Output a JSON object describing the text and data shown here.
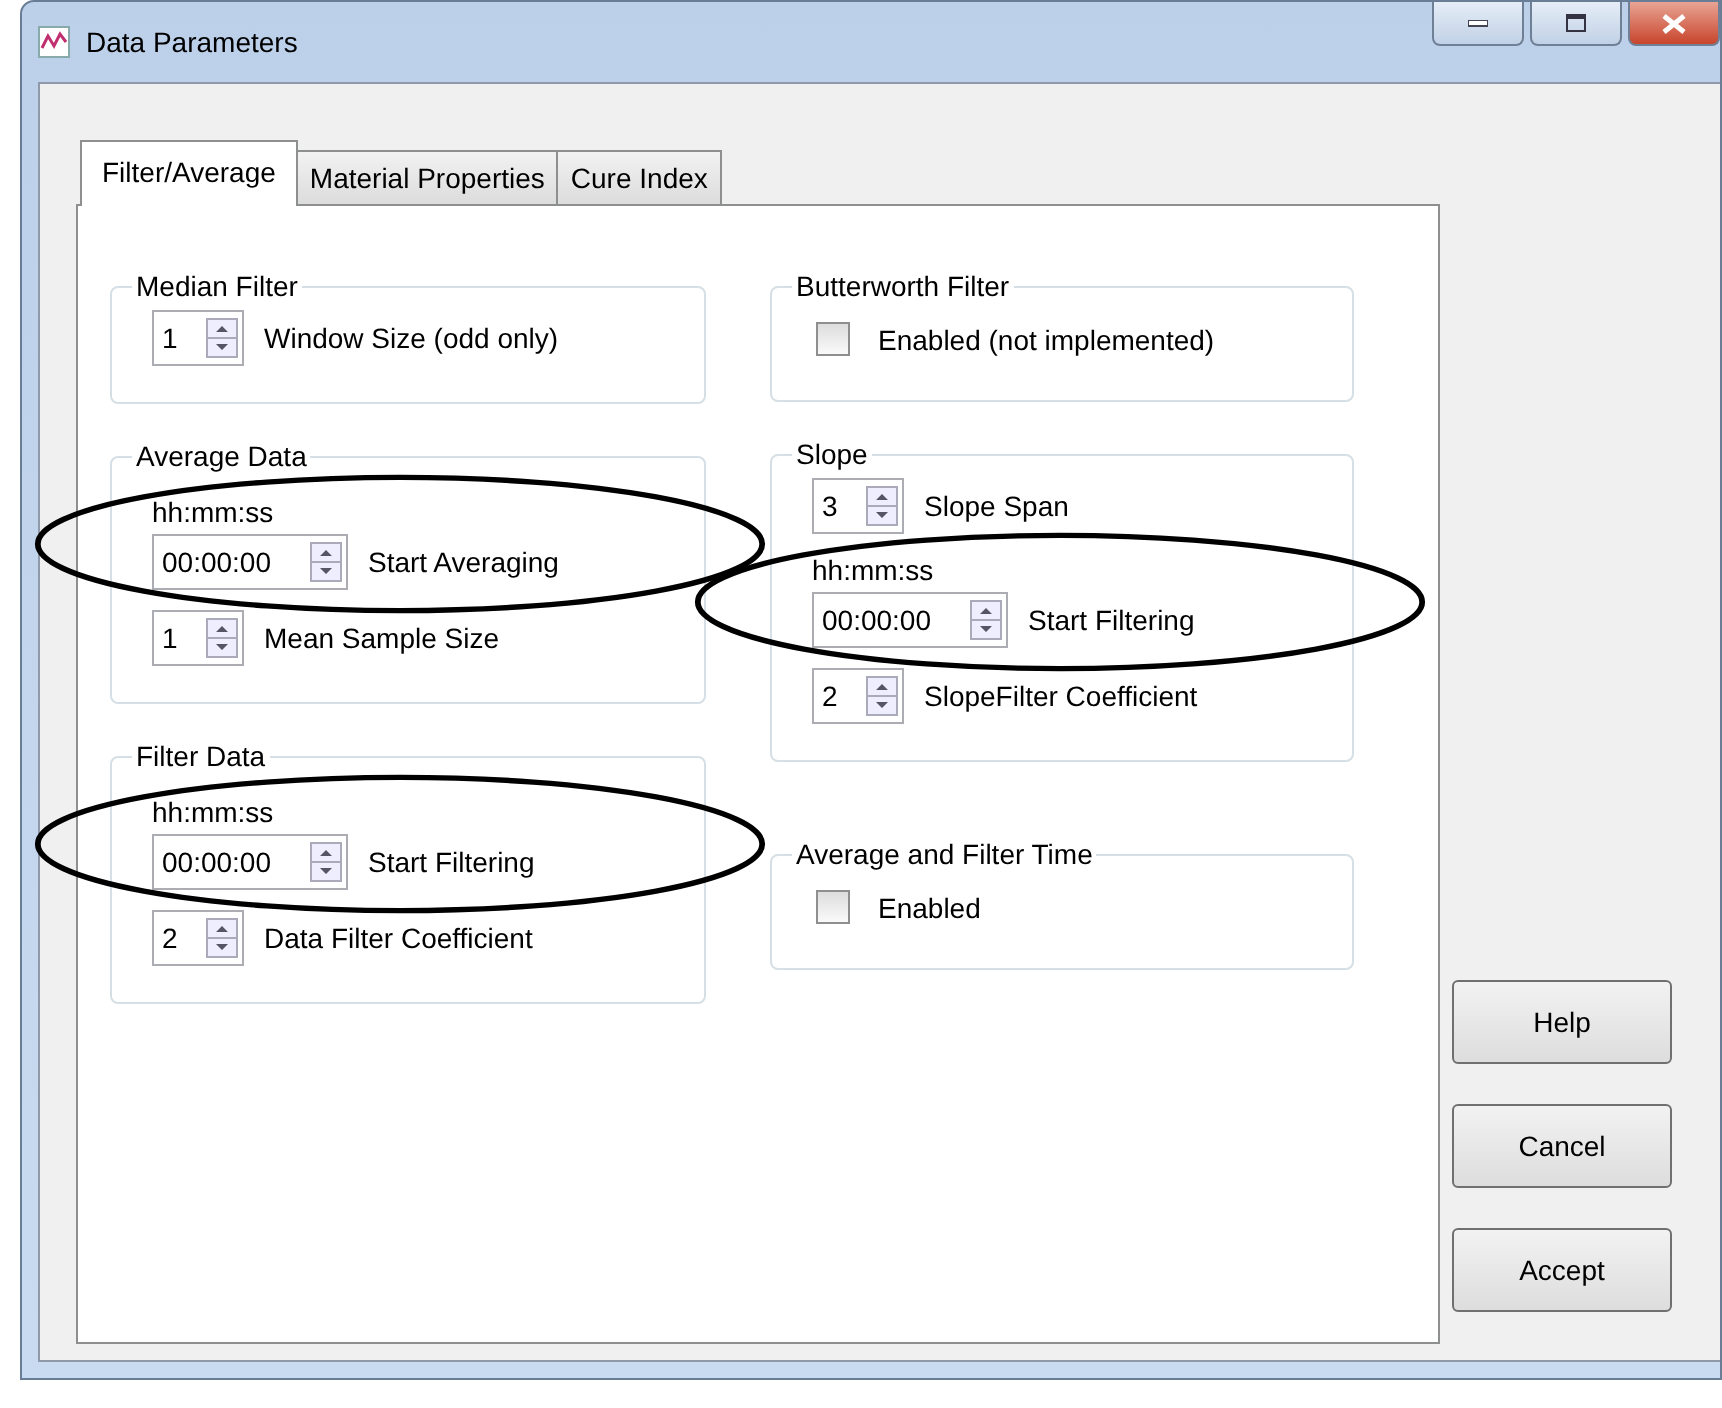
{
  "window": {
    "title": "Data Parameters"
  },
  "tabs": [
    {
      "label": "Filter/Average",
      "selected": true
    },
    {
      "label": "Material Properties",
      "selected": false
    },
    {
      "label": "Cure Index",
      "selected": false
    }
  ],
  "columns": [
    [
      {
        "title": "Median Filter",
        "rows": [
          {
            "kind": "spinner",
            "value": "1",
            "label": "Window Size (odd only)",
            "circled": false
          }
        ]
      },
      {
        "title": "Average Data",
        "rows": [
          {
            "kind": "time",
            "format": "hh:mm:ss",
            "time": "00:00:00",
            "label": "Start Averaging",
            "circled": true
          },
          {
            "kind": "spinner",
            "value": "1",
            "label": "Mean Sample Size",
            "circled": false
          }
        ]
      },
      {
        "title": "Filter Data",
        "rows": [
          {
            "kind": "time",
            "format": "hh:mm:ss",
            "time": "00:00:00",
            "label": "Start Filtering",
            "circled": true
          },
          {
            "kind": "spinner",
            "value": "2",
            "label": "Data Filter Coefficient",
            "circled": false
          }
        ]
      }
    ],
    [
      {
        "title": "Butterworth Filter",
        "rows": [
          {
            "kind": "checkbox",
            "checked": false,
            "label": "Enabled (not implemented)",
            "circled": false
          }
        ]
      },
      {
        "title": "Slope",
        "rows": [
          {
            "kind": "spinner",
            "value": "3",
            "label": "Slope Span",
            "circled": false
          },
          {
            "kind": "time",
            "format": "hh:mm:ss",
            "time": "00:00:00",
            "label": "Start Filtering",
            "circled": true
          },
          {
            "kind": "spinner",
            "value": "2",
            "label": "SlopeFilter Coefficient",
            "circled": false
          }
        ]
      },
      {
        "title": "Average and Filter Time",
        "rows": [
          {
            "kind": "checkbox",
            "checked": false,
            "label": "Enabled",
            "circled": false
          }
        ]
      }
    ]
  ],
  "buttons": [
    "Help",
    "Cancel",
    "Accept"
  ]
}
